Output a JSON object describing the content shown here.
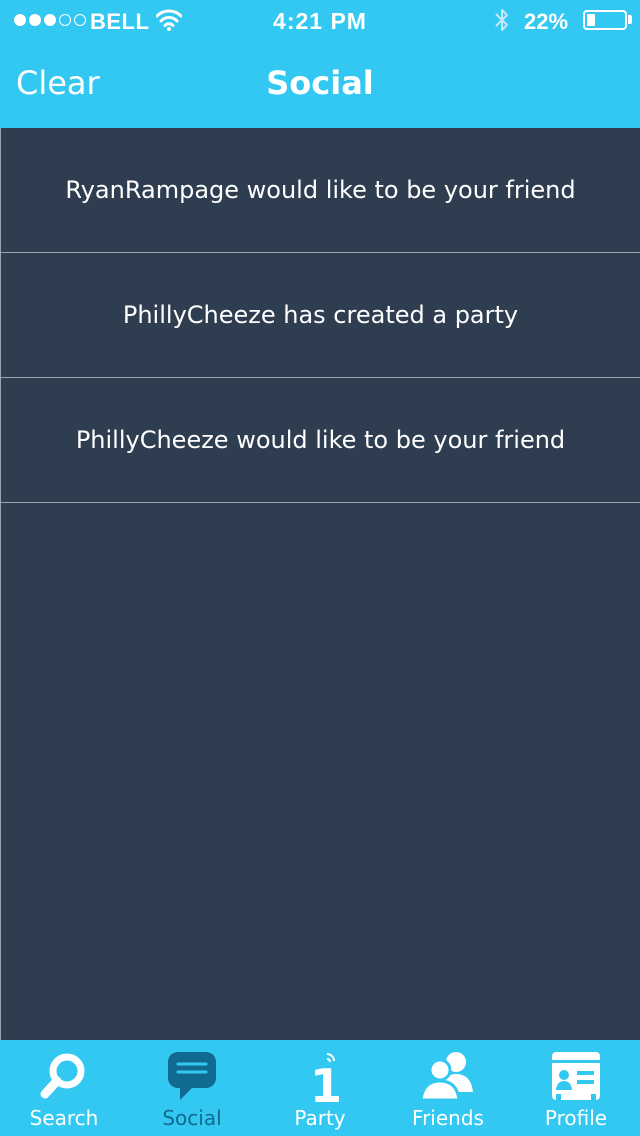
{
  "status_bar": {
    "signal_dots": [
      true,
      true,
      true,
      false,
      false
    ],
    "carrier": "BELL",
    "time": "4:21 PM",
    "battery_text": "22%",
    "battery_level": 0.22,
    "icons": {
      "wifi": "wifi-icon",
      "bluetooth": "bluetooth-icon",
      "battery": "battery-icon"
    }
  },
  "nav": {
    "left_button": "Clear",
    "title": "Social"
  },
  "notifications": [
    {
      "text": "RyanRampage would like to be your friend"
    },
    {
      "text": "PhillyCheeze has created a party"
    },
    {
      "text": "PhillyCheeze would like to be your friend"
    }
  ],
  "tabs": [
    {
      "label": "Search",
      "icon": "search-icon",
      "active": false
    },
    {
      "label": "Social",
      "icon": "chat-bubble-icon",
      "active": true
    },
    {
      "label": "Party",
      "icon": "party-one-icon",
      "active": false
    },
    {
      "label": "Friends",
      "icon": "friends-icon",
      "active": false
    },
    {
      "label": "Profile",
      "icon": "profile-card-icon",
      "active": false
    }
  ],
  "colors": {
    "accent": "#33c8f1",
    "background": "#2e3d50",
    "active_tab": "#116a8f",
    "divider": "#9aa4ae"
  }
}
